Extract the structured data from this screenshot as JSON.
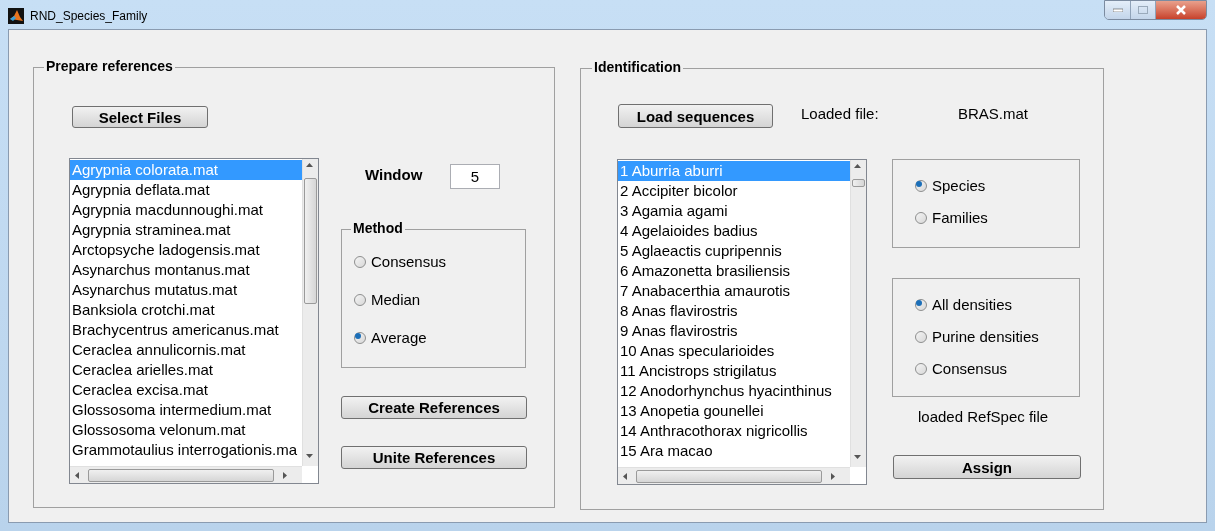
{
  "window": {
    "title": "RND_Species_Family"
  },
  "prepare": {
    "title": "Prepare references",
    "select_button": "Select Files",
    "files": [
      {
        "label": "Agrypnia colorata.mat",
        "selected": true
      },
      {
        "label": "Agrypnia deflata.mat",
        "selected": false
      },
      {
        "label": "Agrypnia macdunnoughi.mat",
        "selected": false
      },
      {
        "label": "Agrypnia straminea.mat",
        "selected": false
      },
      {
        "label": "Arctopsyche ladogensis.mat",
        "selected": false
      },
      {
        "label": "Asynarchus montanus.mat",
        "selected": false
      },
      {
        "label": "Asynarchus mutatus.mat",
        "selected": false
      },
      {
        "label": "Banksiola crotchi.mat",
        "selected": false
      },
      {
        "label": "Brachycentrus americanus.mat",
        "selected": false
      },
      {
        "label": "Ceraclea annulicornis.mat",
        "selected": false
      },
      {
        "label": "Ceraclea arielles.mat",
        "selected": false
      },
      {
        "label": "Ceraclea excisa.mat",
        "selected": false
      },
      {
        "label": "Glossosoma intermedium.mat",
        "selected": false
      },
      {
        "label": "Glossosoma velonum.mat",
        "selected": false
      },
      {
        "label": "Grammotaulius interrogationis.ma",
        "selected": false
      }
    ],
    "window_label": "Window",
    "window_value": "5",
    "method": {
      "title": "Method",
      "options": [
        {
          "label": "Consensus",
          "selected": false
        },
        {
          "label": "Median",
          "selected": false
        },
        {
          "label": "Average",
          "selected": true
        }
      ]
    },
    "create_button": "Create References",
    "unite_button": "Unite References"
  },
  "identification": {
    "title": "Identification",
    "load_button": "Load sequences",
    "loaded_label": "Loaded file:",
    "loaded_value": "BRAS.mat",
    "sequences": [
      {
        "label": "1 Aburria aburri",
        "selected": true
      },
      {
        "label": "2 Accipiter bicolor",
        "selected": false
      },
      {
        "label": "3 Agamia agami",
        "selected": false
      },
      {
        "label": "4 Agelaioides badius",
        "selected": false
      },
      {
        "label": "5 Aglaeactis cupripennis",
        "selected": false
      },
      {
        "label": "6 Amazonetta brasiliensis",
        "selected": false
      },
      {
        "label": "7 Anabacerthia amaurotis",
        "selected": false
      },
      {
        "label": "8 Anas flavirostris",
        "selected": false
      },
      {
        "label": "9 Anas flavirostris",
        "selected": false
      },
      {
        "label": "10 Anas specularioides",
        "selected": false
      },
      {
        "label": "11 Ancistrops strigilatus",
        "selected": false
      },
      {
        "label": "12 Anodorhynchus hyacinthinus",
        "selected": false
      },
      {
        "label": "13 Anopetia gounellei",
        "selected": false
      },
      {
        "label": "14 Anthracothorax nigricollis",
        "selected": false
      },
      {
        "label": "15 Ara macao",
        "selected": false
      }
    ],
    "level_options": [
      {
        "label": "Species",
        "selected": true
      },
      {
        "label": "Families",
        "selected": false
      }
    ],
    "density_options": [
      {
        "label": "All densities",
        "selected": true
      },
      {
        "label": "Purine densities",
        "selected": false
      },
      {
        "label": "Consensus",
        "selected": false
      }
    ],
    "refspec_label": "loaded RefSpec file",
    "assign_button": "Assign"
  }
}
